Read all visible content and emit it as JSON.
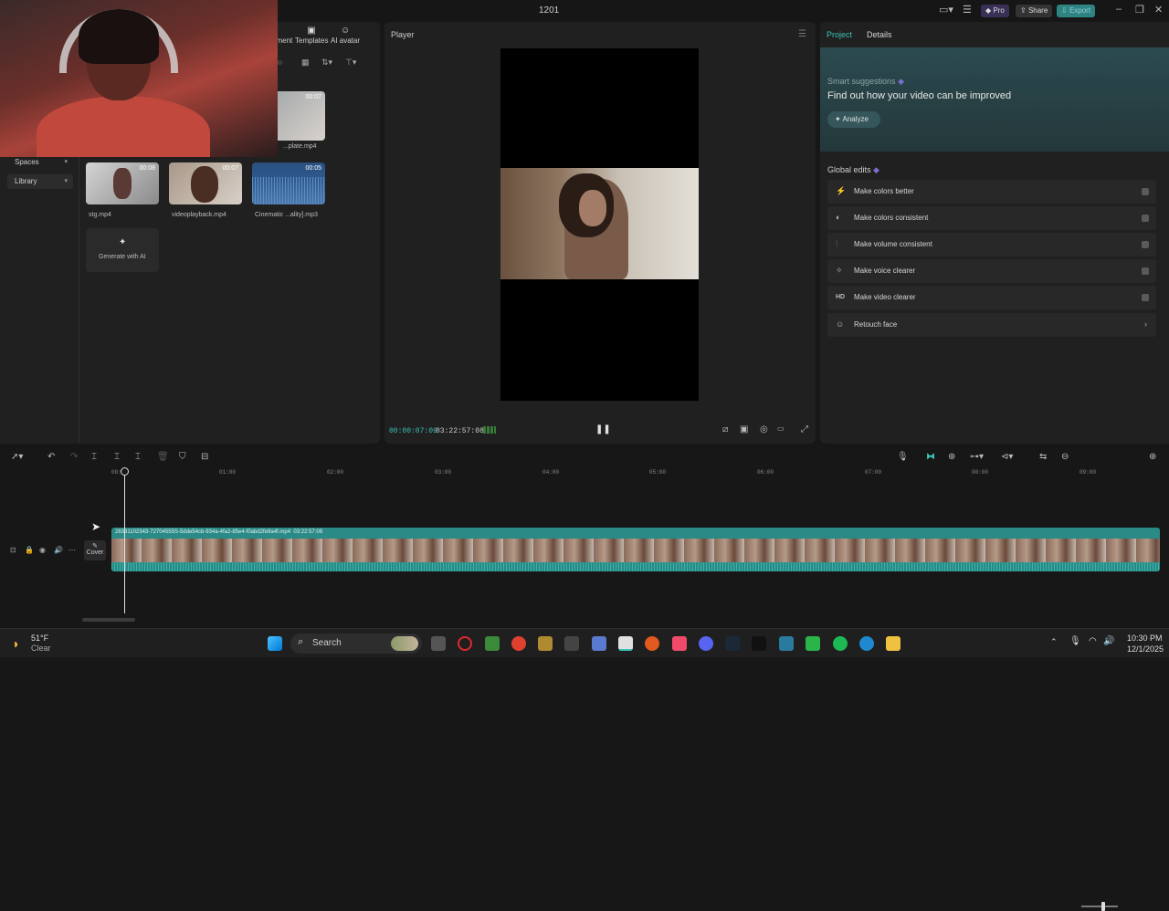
{
  "window": {
    "title": "1201",
    "pro_label": "Pro",
    "share_label": "Share",
    "export_label": "Export"
  },
  "media": {
    "topnav": [
      {
        "label": "ement"
      },
      {
        "label": "Templates"
      },
      {
        "label": "AI avatar"
      }
    ],
    "sidebar": [
      {
        "label": "Spaces"
      },
      {
        "label": "Library"
      }
    ],
    "items": [
      {
        "name": "...plate.mp4",
        "duration": "00:07"
      },
      {
        "name": "stg.mp4",
        "duration": "00:08"
      },
      {
        "name": "videoplayback.mp4",
        "duration": "00:07"
      },
      {
        "name": "Cinematic ...ality].mp3",
        "duration": "00:05"
      }
    ],
    "generate_label": "Generate with AI"
  },
  "player": {
    "header": "Player",
    "current_time": "00:00:07:09",
    "total_time": "03:22:57:08"
  },
  "right_panel": {
    "tabs": [
      "Project",
      "Details"
    ],
    "smart_label": "Smart suggestions",
    "smart_heading": "Find out how your video can be improved",
    "analyze_label": "Analyze",
    "global_label": "Global edits",
    "edits": [
      {
        "label": "Make colors better",
        "icon": "magic-wand-icon"
      },
      {
        "label": "Make colors consistent",
        "icon": "palette-icon"
      },
      {
        "label": "Make volume consistent",
        "icon": "sliders-icon"
      },
      {
        "label": "Make voice clearer",
        "icon": "sparkle-icon"
      },
      {
        "label": "Make video clearer",
        "icon": "hd-icon",
        "glyph": "HD"
      },
      {
        "label": "Retouch face",
        "icon": "face-icon"
      }
    ]
  },
  "timeline": {
    "ruler": [
      "00:00",
      "01:00",
      "02:00",
      "03:00",
      "04:00",
      "05:00",
      "06:00",
      "07:00",
      "08:00",
      "09:00"
    ],
    "clip_name": "26331102343-72704555S-5dde54cb-934a-4fa2-85e4-f0abd2fe9a4f.mp4",
    "clip_duration": "03:22:57:08",
    "cover_label": "Cover"
  },
  "taskbar": {
    "weather_temp": "51°F",
    "weather_desc": "Clear",
    "search_label": "Search",
    "time": "10:30 PM",
    "date": "12/1/2025"
  }
}
